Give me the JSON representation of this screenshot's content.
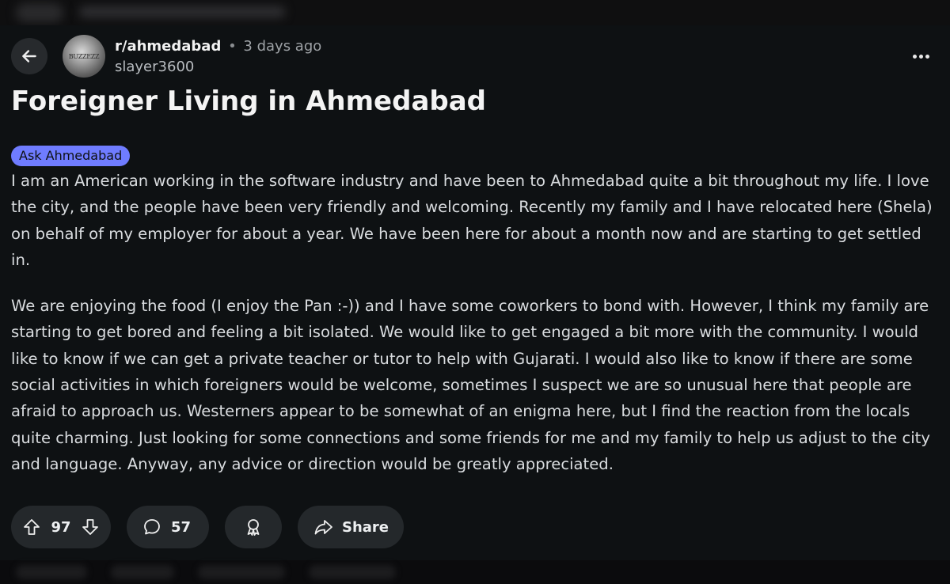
{
  "post": {
    "subreddit": "r/ahmedabad",
    "separator": "•",
    "time": "3 days ago",
    "author": "slayer3600",
    "avatar_label": "BUZZEZZ",
    "title": "Foreigner Living in Ahmedabad",
    "flair": "Ask Ahmedabad",
    "paragraphs": [
      "I am an American working in the software industry and have been to Ahmedabad quite a bit throughout my life. I love the city, and the people have been very friendly and welcoming. Recently my family and I have relocated here (Shela) on behalf of my employer for about a year. We have been here for about a month now and are starting to get settled in.",
      "We are enjoying the food (I enjoy the Pan :-)) and I have some coworkers to bond with. However, I think my family are starting to get bored and feeling a bit isolated. We would like to get engaged a bit more with the community. I would like to know if we can get a private teacher or tutor to help with Gujarati. I would also like to know if there are some social activities in which foreigners would be welcome, sometimes I suspect we are so unusual here that people are afraid to approach us. Westerners appear to be somewhat of an enigma here, but I find the reaction from the locals quite charming. Just looking for some connections and some friends for me and my family to help us adjust to the city and language. Anyway, any advice or direction would be greatly appreciated."
    ]
  },
  "actions": {
    "votes": "97",
    "comments": "57",
    "share_label": "Share"
  },
  "icons": {
    "back": "arrow-left-icon",
    "more": "more-horizontal-icon",
    "upvote": "arrow-up-icon",
    "downvote": "arrow-down-icon",
    "comment": "comment-bubble-icon",
    "award": "award-icon",
    "share": "share-arrow-icon"
  },
  "colors": {
    "background": "#0e1113",
    "flair": "#6f7cff",
    "pill": "#24282b"
  }
}
